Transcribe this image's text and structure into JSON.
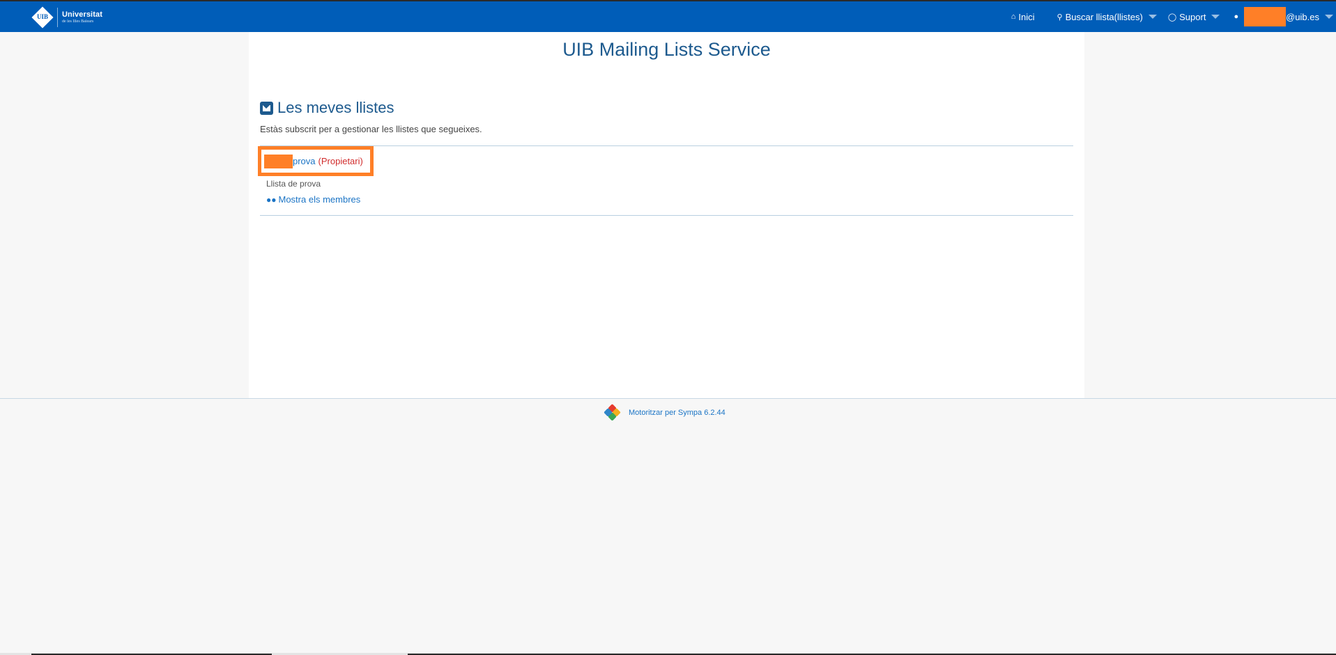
{
  "header": {
    "brand": {
      "logo_text": "UIB",
      "line1": "Universitat",
      "line2": "de les Illes Balears"
    },
    "nav": {
      "home_label": "Inici",
      "search_label": "Buscar llista(llistes)",
      "support_label": "Suport",
      "user_suffix": "@uib.es"
    },
    "colors": {
      "bar": "#005db8",
      "redaction": "#ff7f27"
    }
  },
  "main": {
    "title": "UIB Mailing Lists Service",
    "section_title": "Les meves llistes",
    "intro": "Estàs subscrit per a gestionar les llistes que segueixes.",
    "lists": [
      {
        "name": "prova",
        "role": "(Propietari)",
        "description": "Llista de prova",
        "members_link": "Mostra els membres"
      }
    ]
  },
  "footer": {
    "powered_by": "Motoritzar per Sympa 6.2.44"
  },
  "icons": {
    "home": "home-icon",
    "search": "search-icon",
    "support": "globe-icon",
    "user": "user-icon",
    "section": "envelope-icon",
    "members": "users-icon",
    "footer": "sympa-logo"
  }
}
